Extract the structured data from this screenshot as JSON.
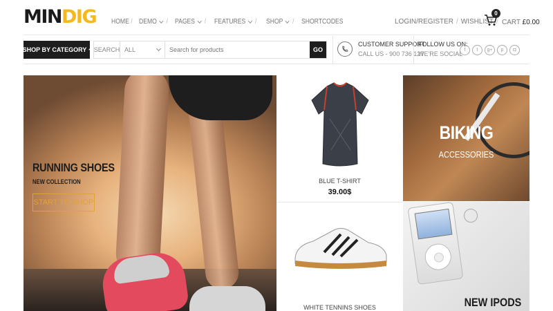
{
  "brand": {
    "logo_part1": "MIN",
    "logo_part2": "DIG"
  },
  "nav": {
    "items": [
      {
        "label": "HOME",
        "has_dropdown": false
      },
      {
        "label": "DEMO",
        "has_dropdown": true
      },
      {
        "label": "PAGES",
        "has_dropdown": true
      },
      {
        "label": "FEATURES",
        "has_dropdown": true
      },
      {
        "label": "SHOP",
        "has_dropdown": true
      },
      {
        "label": "SHORTCODES",
        "has_dropdown": false
      }
    ]
  },
  "account": {
    "login_register": "LOGIN/REGISTER",
    "wishlist": "WISHLIST"
  },
  "cart": {
    "count": "0",
    "label": "CART",
    "amount": "£0.00",
    "icon": "cart-icon"
  },
  "category_button": {
    "label": "SHOP BY CATEGORY"
  },
  "search": {
    "label": "SEARCH",
    "selected_category": "ALL",
    "placeholder": "Search for products",
    "go_label": "GO"
  },
  "support": {
    "icon": "phone-support-icon",
    "title": "CUSTOMER SUPPORT",
    "phone": "CALL US - 900 736 127"
  },
  "follow": {
    "title": "FOLLOW US ON:",
    "subtitle": "WE'RE SOCIAL",
    "icons": [
      {
        "name": "facebook-icon",
        "glyph": "f"
      },
      {
        "name": "twitter-icon",
        "glyph": "t"
      },
      {
        "name": "google-plus-icon",
        "glyph": "g+"
      },
      {
        "name": "pinterest-icon",
        "glyph": "p"
      },
      {
        "name": "instagram-icon",
        "glyph": "◘"
      }
    ]
  },
  "banners": {
    "hero": {
      "title": "RUNNING SHOES",
      "subtitle": "NEW COLLECTION",
      "button": "START TO SHOP",
      "accent": "#e0a23c"
    },
    "tshirt": {
      "name": "BLUE T-SHIRT",
      "price": "39.00$"
    },
    "biking": {
      "title": "BIKING",
      "subtitle": "ACCESSORIES"
    },
    "shoes": {
      "name": "WHITE TENNINS SHOES"
    },
    "ipods": {
      "title": "NEW IPODS"
    }
  },
  "colors": {
    "accent_yellow": "#f5b91f",
    "dark": "#1d1d1d"
  }
}
